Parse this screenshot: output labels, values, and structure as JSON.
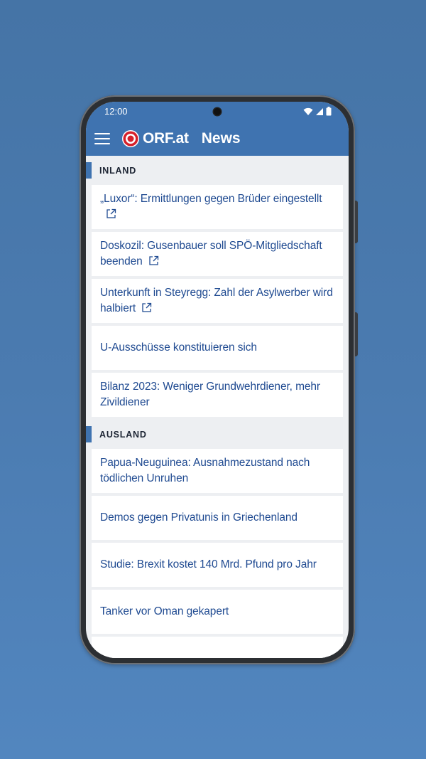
{
  "status_bar": {
    "time": "12:00"
  },
  "appbar": {
    "brand": "ORF.at",
    "title": "News"
  },
  "colors": {
    "accent": "#3f73b0",
    "headline": "#1f4a91",
    "brand_red": "#d6202a"
  },
  "sections": [
    {
      "label": "INLAND",
      "items": [
        {
          "title": "„Luxor“: Ermittlungen gegen Brüder eingestellt",
          "external": true
        },
        {
          "title": "Doskozil: Gusenbauer soll SPÖ-Mitgliedschaft beenden",
          "external": true
        },
        {
          "title": "Unterkunft in Steyregg: Zahl der Asylwerber wird halbiert",
          "external": true
        },
        {
          "title": "U-Ausschüsse konstituieren sich",
          "external": false
        },
        {
          "title": "Bilanz 2023: Weniger Grundwehrdiener, mehr Zivildiener",
          "external": false
        }
      ]
    },
    {
      "label": "AUSLAND",
      "items": [
        {
          "title": "Papua-Neuguinea: Ausnahmezustand nach tödlichen Unruhen",
          "external": false
        },
        {
          "title": "Demos gegen Privatunis in Griechenland",
          "external": false
        },
        {
          "title": "Studie: Brexit kostet 140 Mrd. Pfund pro Jahr",
          "external": false
        },
        {
          "title": "Tanker vor Oman gekapert",
          "external": false
        }
      ]
    }
  ]
}
